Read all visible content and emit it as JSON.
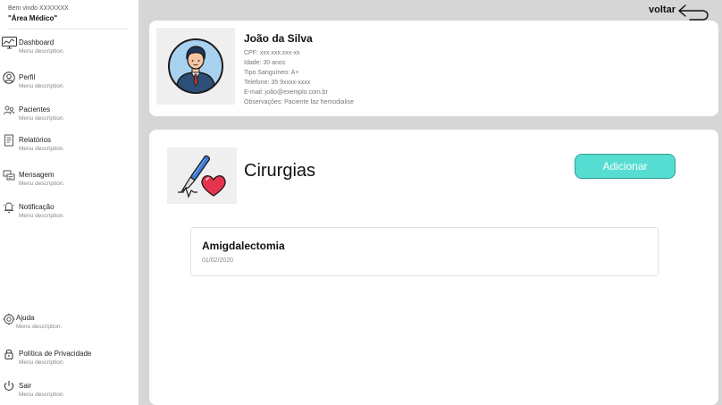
{
  "sidebar": {
    "welcome": "Bem vindo XXXXXXX",
    "area": "\"Área Médico\"",
    "items": [
      {
        "label": "Dashboard",
        "desc": "Menu description.",
        "icon": "dashboard-icon"
      },
      {
        "label": "Perfil",
        "desc": "Menu description.",
        "icon": "user-icon"
      },
      {
        "label": "Pacientes",
        "desc": "Menu description.",
        "icon": "patients-icon"
      },
      {
        "label": "Relatórios",
        "desc": "Menu description.",
        "icon": "report-icon"
      },
      {
        "label": "Mensagem",
        "desc": "Menu description.",
        "icon": "message-icon"
      },
      {
        "label": "Notificação",
        "desc": "Menu description.",
        "icon": "bell-icon"
      }
    ],
    "bottom_items": [
      {
        "label": "Ajuda",
        "desc": "Menu description.",
        "icon": "help-icon"
      },
      {
        "label": "Política de Privacidade",
        "desc": "Menu description.",
        "icon": "lock-icon"
      },
      {
        "label": "Sair",
        "desc": "Menu description.",
        "icon": "power-icon"
      }
    ]
  },
  "header": {
    "back_label": "voltar"
  },
  "patient": {
    "name": "João da Silva",
    "cpf": "CPF: xxx.xxx.xxx-xx",
    "age": "Idade: 30 anos",
    "blood": "Tipo Sanguíneo: A+",
    "phone": "Telefone: 35 9xxxx-xxxx",
    "email": "E-mail: joão@exemplo.com.br",
    "notes": "Observações: Paciente faz hemodialise"
  },
  "surgeries": {
    "title": "Cirurgias",
    "add_label": "Adicionar",
    "items": [
      {
        "name": "Amigdalectomia",
        "date": "01/02/2020"
      }
    ]
  },
  "colors": {
    "accent": "#56ddd1",
    "background": "#d6d6d6"
  }
}
